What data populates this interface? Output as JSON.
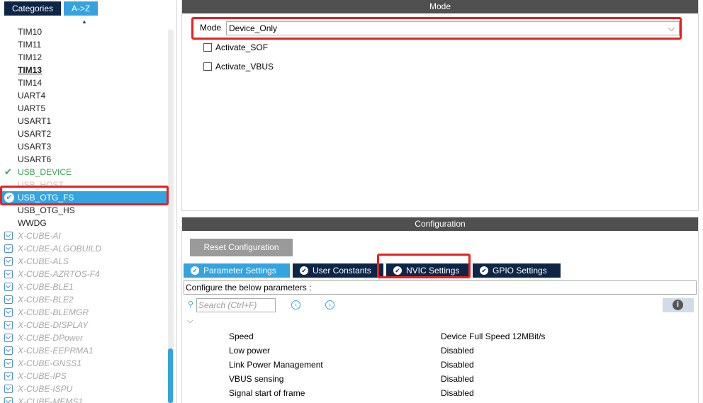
{
  "left_panel": {
    "tabs": {
      "categories": "Categories",
      "az": "A->Z"
    },
    "sort_indicator": "▲",
    "items": [
      {
        "label": "TIM10",
        "state": "normal"
      },
      {
        "label": "TIM11",
        "state": "normal"
      },
      {
        "label": "TIM12",
        "state": "normal"
      },
      {
        "label": "TIM13",
        "state": "bold"
      },
      {
        "label": "TIM14",
        "state": "normal"
      },
      {
        "label": "UART4",
        "state": "normal"
      },
      {
        "label": "UART5",
        "state": "normal"
      },
      {
        "label": "USART1",
        "state": "normal"
      },
      {
        "label": "USART2",
        "state": "normal"
      },
      {
        "label": "USART3",
        "state": "normal"
      },
      {
        "label": "USART6",
        "state": "normal"
      },
      {
        "label": "USB_DEVICE",
        "state": "enabled"
      },
      {
        "label": "USB_HOST",
        "state": "disabled"
      },
      {
        "label": "USB_OTG_FS",
        "state": "selected"
      },
      {
        "label": "USB_OTG_HS",
        "state": "normal"
      },
      {
        "label": "WWDG",
        "state": "normal"
      },
      {
        "label": "X-CUBE-AI",
        "state": "cube"
      },
      {
        "label": "X-CUBE-ALGOBUILD",
        "state": "cube"
      },
      {
        "label": "X-CUBE-ALS",
        "state": "cube"
      },
      {
        "label": "X-CUBE-AZRTOS-F4",
        "state": "cube"
      },
      {
        "label": "X-CUBE-BLE1",
        "state": "cube"
      },
      {
        "label": "X-CUBE-BLE2",
        "state": "cube"
      },
      {
        "label": "X-CUBE-BLEMGR",
        "state": "cube"
      },
      {
        "label": "X-CUBE-DISPLAY",
        "state": "cube"
      },
      {
        "label": "X-CUBE-DPower",
        "state": "cube"
      },
      {
        "label": "X-CUBE-EEPRMA1",
        "state": "cube"
      },
      {
        "label": "X-CUBE-GNSS1",
        "state": "cube"
      },
      {
        "label": "X-CUBE-IPS",
        "state": "cube"
      },
      {
        "label": "X-CUBE-ISPU",
        "state": "cube"
      },
      {
        "label": "X-CUBE-MEMS1",
        "state": "cube"
      }
    ]
  },
  "mode_panel": {
    "title": "Mode",
    "mode_label": "Mode",
    "mode_value": "Device_Only",
    "checkboxes": [
      {
        "label": "Activate_SOF",
        "checked": false
      },
      {
        "label": "Activate_VBUS",
        "checked": false
      }
    ]
  },
  "config_panel": {
    "title": "Configuration",
    "reset_button": "Reset Configuration",
    "tabs": [
      {
        "label": "Parameter Settings",
        "active": true
      },
      {
        "label": "User Constants",
        "active": false
      },
      {
        "label": "NVIC Settings",
        "active": false
      },
      {
        "label": "GPIO Settings",
        "active": false
      }
    ],
    "params_caption": "Configure the below parameters :",
    "search_placeholder": "Search (Ctrl+F)",
    "parameters": [
      {
        "name": "Speed",
        "value": "Device Full Speed 12MBit/s"
      },
      {
        "name": "Low power",
        "value": "Disabled"
      },
      {
        "name": "Link Power Management",
        "value": "Disabled"
      },
      {
        "name": "VBUS sensing",
        "value": "Disabled"
      },
      {
        "name": "Signal start of frame",
        "value": "Disabled"
      }
    ]
  },
  "colors": {
    "navy": "#0d2647",
    "accent_blue": "#35a3df",
    "header_gray": "#505050",
    "enabled_green": "#3aa452",
    "highlight_red": "#e8211f"
  },
  "icons": {
    "check": "✔",
    "dropdown": "⌵",
    "prev": "‹",
    "next": "›",
    "info": "i",
    "search": "⚲"
  }
}
